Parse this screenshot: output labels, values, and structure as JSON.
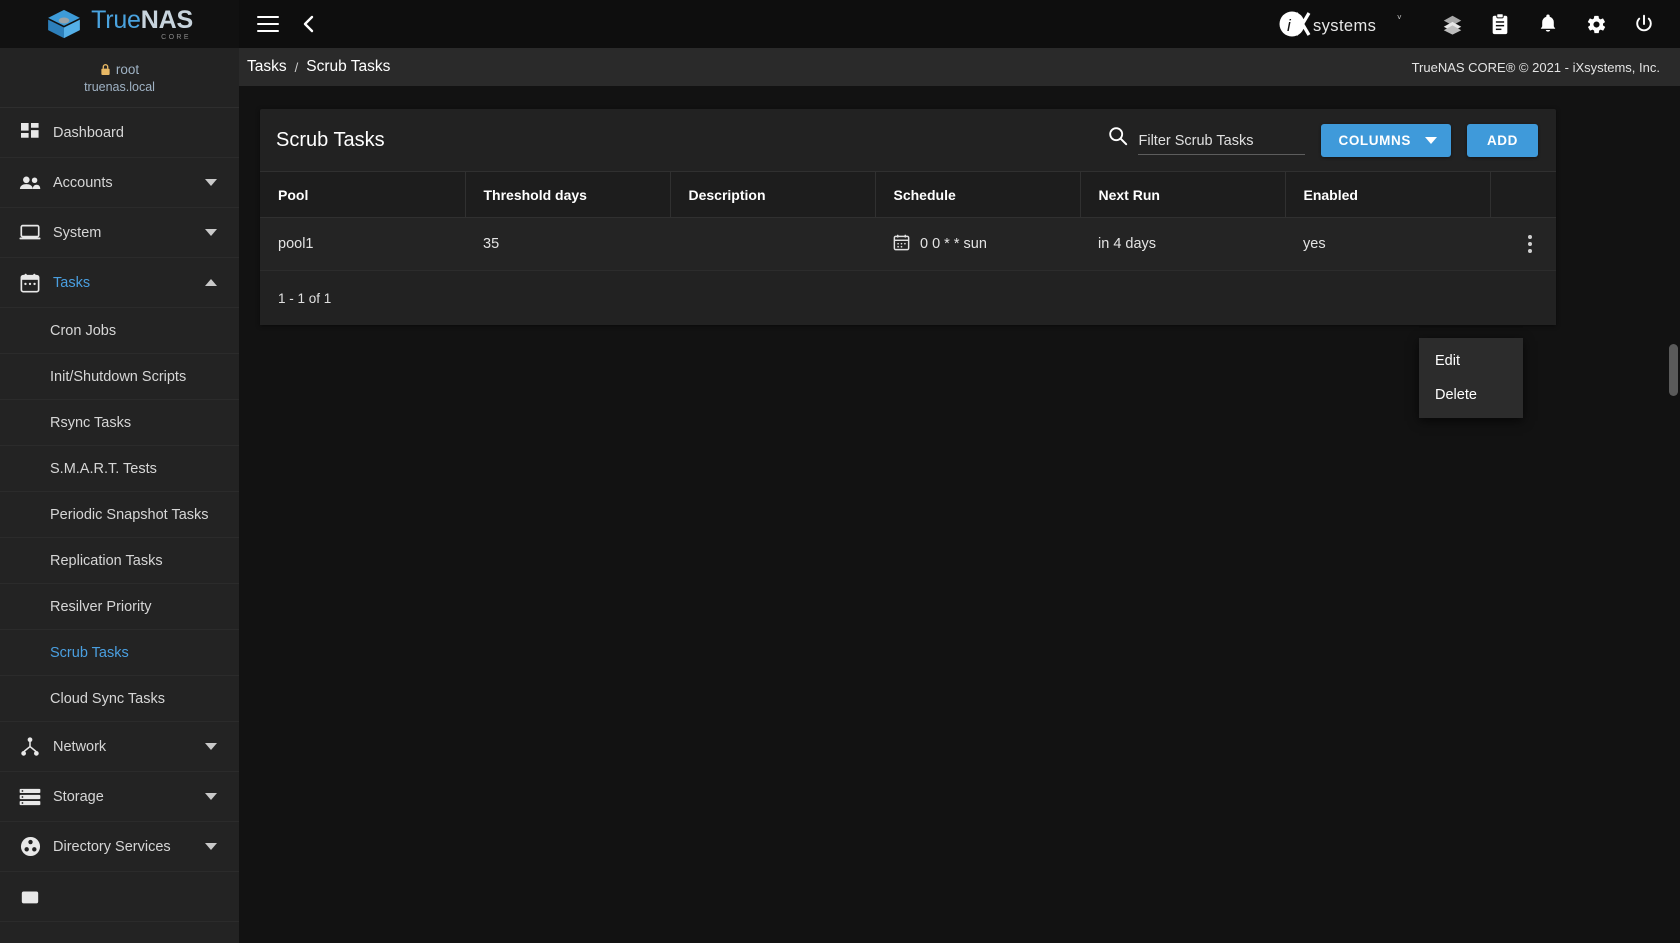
{
  "topbar": {
    "logo": {
      "true": "True",
      "nas": "NAS",
      "sub": "CORE"
    },
    "menu_icon": "hamburger-icon",
    "back_icon": "chevron-left-icon",
    "ix_brand": "iXsystems",
    "icons": [
      "jails-icon",
      "tasks-clipboard-icon",
      "notifications-bell-icon",
      "settings-gear-icon",
      "power-icon"
    ]
  },
  "sidebar": {
    "user": {
      "name": "root",
      "host": "truenas.local",
      "lock_icon": "lock-icon"
    },
    "items": [
      {
        "label": "Dashboard",
        "icon": "dashboard-icon",
        "caret": "none",
        "active": false
      },
      {
        "label": "Accounts",
        "icon": "accounts-icon",
        "caret": "down",
        "active": false
      },
      {
        "label": "System",
        "icon": "system-icon",
        "caret": "down",
        "active": false
      },
      {
        "label": "Tasks",
        "icon": "tasks-calendar-icon",
        "caret": "up",
        "active": true
      }
    ],
    "sub_items": [
      {
        "label": "Cron Jobs",
        "active": false
      },
      {
        "label": "Init/Shutdown Scripts",
        "active": false
      },
      {
        "label": "Rsync Tasks",
        "active": false
      },
      {
        "label": "S.M.A.R.T. Tests",
        "active": false
      },
      {
        "label": "Periodic Snapshot Tasks",
        "active": false
      },
      {
        "label": "Replication Tasks",
        "active": false
      },
      {
        "label": "Resilver Priority",
        "active": false
      },
      {
        "label": "Scrub Tasks",
        "active": true
      },
      {
        "label": "Cloud Sync Tasks",
        "active": false
      }
    ],
    "items_after": [
      {
        "label": "Network",
        "icon": "network-icon",
        "caret": "down",
        "active": false
      },
      {
        "label": "Storage",
        "icon": "storage-icon",
        "caret": "down",
        "active": false
      },
      {
        "label": "Directory Services",
        "icon": "directory-services-icon",
        "caret": "down",
        "active": false
      }
    ]
  },
  "breadcrumb": {
    "parent": "Tasks",
    "separator": "/",
    "current": "Scrub Tasks",
    "copyright": "TrueNAS CORE® © 2021 - iXsystems, Inc."
  },
  "card": {
    "title": "Scrub Tasks",
    "search": {
      "placeholder": "Filter Scrub Tasks",
      "value": "",
      "icon": "search-icon"
    },
    "columns_button": "COLUMNS",
    "add_button": "ADD"
  },
  "table": {
    "columns": [
      "Pool",
      "Threshold days",
      "Description",
      "Schedule",
      "Next Run",
      "Enabled"
    ],
    "rows": [
      {
        "pool": "pool1",
        "threshold_days": "35",
        "description": "",
        "schedule": "0 0 * * sun",
        "schedule_icon": "calendar-icon",
        "next_run": "in 4 days",
        "enabled": "yes",
        "menu_icon": "kebab-menu-icon"
      }
    ],
    "paginator": "1 - 1 of 1"
  },
  "context_menu": {
    "items": [
      {
        "label": "Edit"
      },
      {
        "label": "Delete"
      }
    ]
  },
  "colors": {
    "accent": "#3f9ada",
    "link": "#4a9fe0",
    "bg": "#121212",
    "card_bg": "#222222",
    "sidebar_bg": "#232323"
  }
}
